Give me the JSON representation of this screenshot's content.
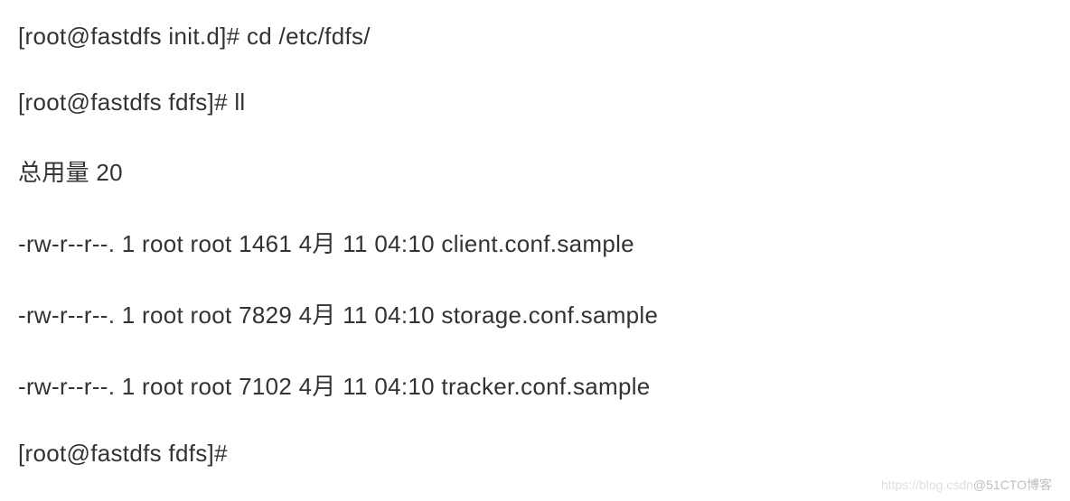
{
  "terminal": {
    "lines": [
      "[root@fastdfs init.d]# cd /etc/fdfs/",
      "[root@fastdfs fdfs]# ll",
      "总用量 20",
      "-rw-r--r--. 1 root root 1461 4月 11 04:10 client.conf.sample",
      "-rw-r--r--. 1 root root 7829 4月 11 04:10 storage.conf.sample",
      "-rw-r--r--. 1 root root 7102 4月 11 04:10 tracker.conf.sample",
      "[root@fastdfs fdfs]#"
    ]
  },
  "watermark": {
    "blog": "https://blog.csdn",
    "cto": "@51CTO博客"
  }
}
